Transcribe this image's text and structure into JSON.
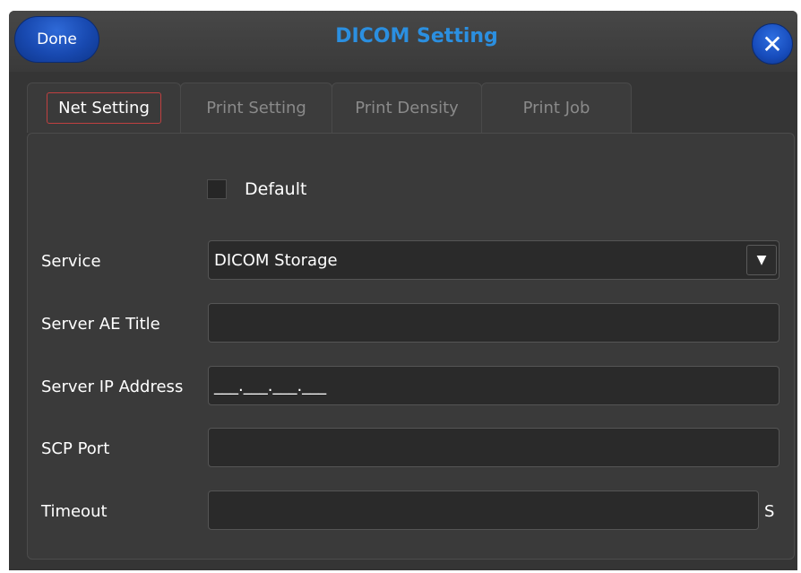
{
  "header": {
    "done_label": "Done",
    "title": "DICOM Setting",
    "close_label": "✕"
  },
  "tabs": [
    {
      "label": "Net Setting",
      "active": true
    },
    {
      "label": "Print Setting",
      "active": false
    },
    {
      "label": "Print Density",
      "active": false
    },
    {
      "label": "Print Job",
      "active": false
    }
  ],
  "form": {
    "default_checkbox": {
      "label": "Default",
      "checked": false
    },
    "service": {
      "label": "Service",
      "value": "DICOM Storage",
      "dropdown_icon": "triangle-down-icon"
    },
    "server_ae_title": {
      "label": "Server AE Title",
      "value": ""
    },
    "server_ip": {
      "label": "Server IP Address",
      "value": "___.___.___.___"
    },
    "scp_port": {
      "label": "SCP Port",
      "value": ""
    },
    "timeout": {
      "label": "Timeout",
      "value": "",
      "unit": "S"
    }
  },
  "colors": {
    "accent_blue": "#1849b0",
    "title_blue": "#2b8fe0",
    "background": "#353535",
    "active_tab_border": "#c04040"
  }
}
